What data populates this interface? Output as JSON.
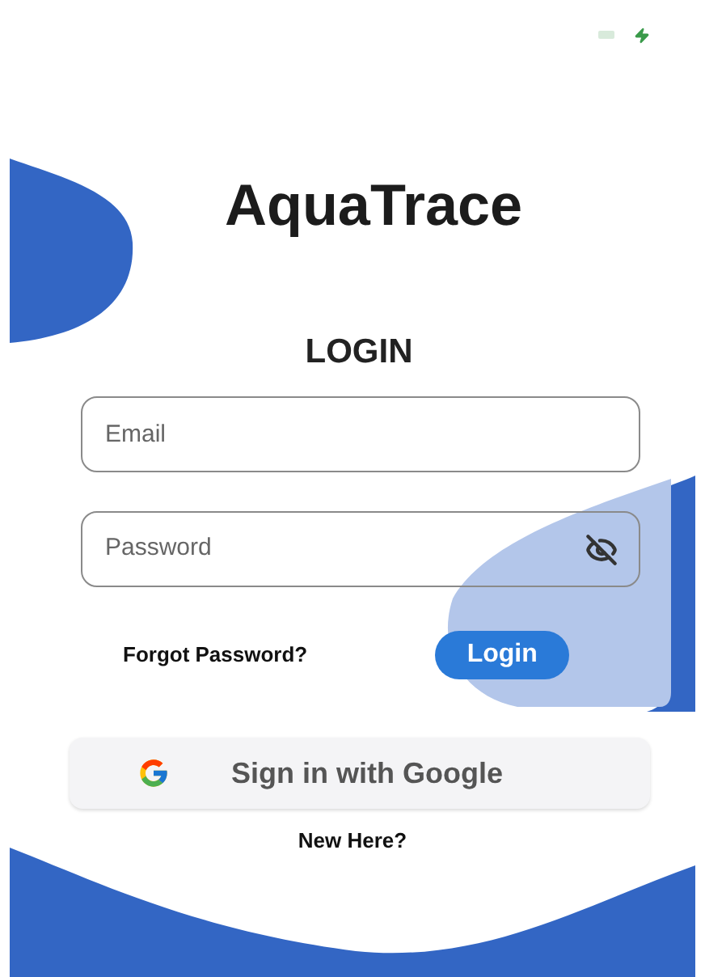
{
  "app_title": "AquaTrace",
  "heading": "LOGIN",
  "email": {
    "placeholder": "Email"
  },
  "password": {
    "placeholder": "Password",
    "visible": false
  },
  "forgot_link": "Forgot Password?",
  "login_button": "Login",
  "google_button": "Sign in with Google",
  "signup_link": "New Here?"
}
